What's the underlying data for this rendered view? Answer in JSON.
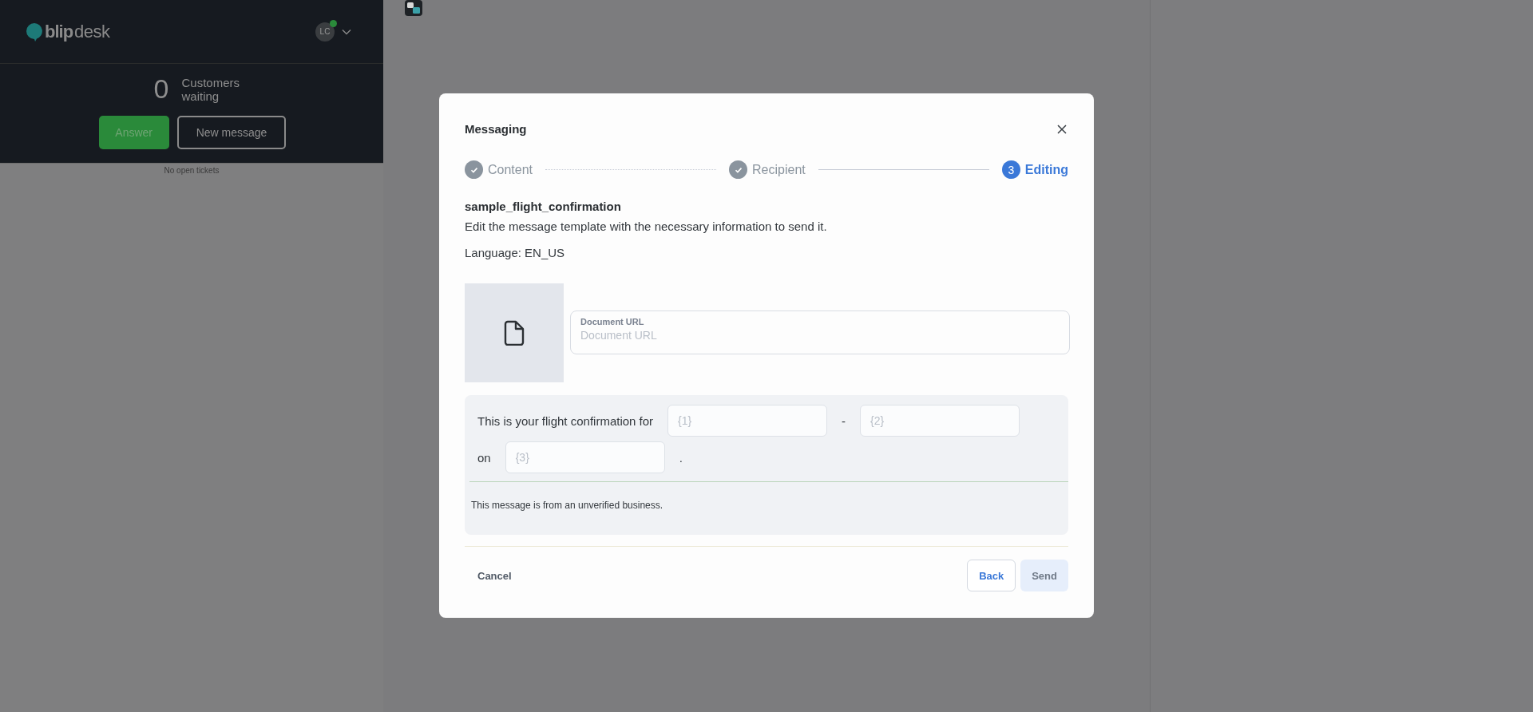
{
  "sidebar": {
    "logo": {
      "brand": "blip",
      "product": "desk"
    },
    "avatar": {
      "initials": "LC",
      "online": true
    },
    "waiting": {
      "count": "0",
      "label": "Customers waiting"
    },
    "buttons": [
      {
        "label": "Answer",
        "kind": "primary"
      },
      {
        "label": "New message",
        "kind": "outline"
      }
    ],
    "empty_text": "No open tickets"
  },
  "modal": {
    "title": "Messaging",
    "steps": [
      {
        "label": "Content",
        "completed": true,
        "selected": false
      },
      {
        "label": "Recipient",
        "completed": true,
        "selected": false
      },
      {
        "label": "Editing",
        "number": "3",
        "completed": false,
        "selected": true
      }
    ],
    "template_name": "sample_flight_confirmation",
    "description": "Edit the message template with the necessary information to send it.",
    "language": "Language: EN_US",
    "media": {
      "kind": "document",
      "field": {
        "label": "Document URL",
        "placeholder": "Document URL"
      }
    },
    "body": {
      "lines": [
        [
          {
            "kind": "text",
            "text": "This is your flight confirmation for"
          },
          {
            "kind": "field",
            "placeholder": "{1}"
          },
          {
            "kind": "text",
            "text": "-"
          },
          {
            "kind": "field",
            "placeholder": "{2}"
          }
        ],
        [
          {
            "kind": "text",
            "text": "on"
          },
          {
            "kind": "field",
            "placeholder": "{3}"
          },
          {
            "kind": "text",
            "text": "."
          }
        ]
      ],
      "note": "This message is from an unverified business."
    },
    "footer": {
      "cancel": "Cancel",
      "actions": [
        {
          "label": "Back",
          "kind": "outline",
          "disabled": false
        },
        {
          "label": "Send",
          "kind": "primary",
          "disabled": true
        }
      ]
    }
  }
}
